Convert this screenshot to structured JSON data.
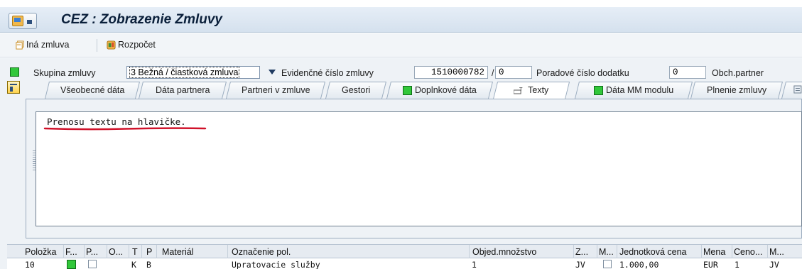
{
  "window": {
    "title": "CEZ : Zobrazenie Zmluvy"
  },
  "toolbar": {
    "other_contract": "Iná zmluva",
    "budget": "Rozpočet"
  },
  "header": {
    "group_label": "Skupina zmluvy",
    "group_value": "3 Bežná / čiastková zmluva",
    "record_label": "Evidenčné číslo zmluvy",
    "record_value": "1510000782",
    "slash": "/",
    "record_suffix": "0",
    "seq_label": "Poradové číslo dodatku",
    "seq_value": "0",
    "partner_label": "Obch.partner"
  },
  "tabs": [
    {
      "label": "Všeobecné dáta"
    },
    {
      "label": "Dáta partnera"
    },
    {
      "label": "Partneri v zmluve"
    },
    {
      "label": "Gestori"
    },
    {
      "label": "Doplnkové dáta"
    },
    {
      "label": "Texty"
    },
    {
      "label": "Dáta MM modulu"
    },
    {
      "label": "Plnenie zmluvy"
    }
  ],
  "editor": {
    "text": "Prenosu textu na hlavičke."
  },
  "items_table": {
    "columns": [
      "Položka",
      "F...",
      "P...",
      "O...",
      "T",
      "P",
      "Materiál",
      "Označenie pol.",
      "Objed.množstvo",
      "Z...",
      "M...",
      "Jednotková cena",
      "Mena",
      "Ceno...",
      "M..."
    ],
    "rows": [
      {
        "item": "10",
        "t": "K",
        "p": "B",
        "desc": "Upratovacie služby",
        "qty": "1",
        "unit": "JV",
        "price": "1.000,00",
        "currency": "EUR",
        "price_unit": "1",
        "m": "JV"
      }
    ]
  },
  "colors": {
    "accent_green": "#31c73a",
    "underline_red": "#d0122a"
  }
}
